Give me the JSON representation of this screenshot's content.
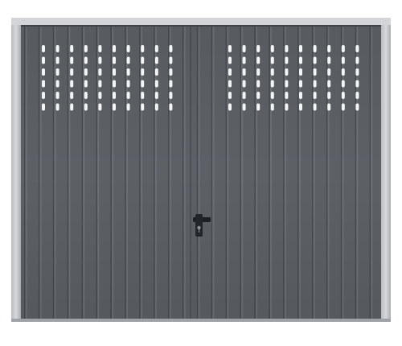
{
  "image": {
    "subject": "garage-door",
    "style": "up-and-over vertical-ribbed steel panel with ventilation slots",
    "colors": {
      "background": "#ffffff",
      "frame": "#c4c7cb",
      "frame_shadow": "#9da1a6",
      "panel": "#5d6166",
      "rib_light": "#6c7075",
      "rib_dark": "#474b50",
      "vent_slot": "#f4f5f6",
      "handle": "#1c1e21"
    },
    "vent_rows": 6,
    "vent_columns_per_side": 10,
    "features": [
      "frame-icon",
      "ventilation-slots",
      "door-handle-icon",
      "keyhole-icon"
    ]
  }
}
